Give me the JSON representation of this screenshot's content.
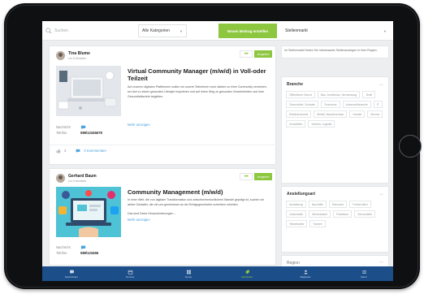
{
  "topbar": {
    "search_placeholder": "Suchen",
    "category_value": "Alle Kategorien",
    "new_post_label": "Neuen Beitrag erstellen",
    "market_label": "Stellenmarkt"
  },
  "posts": [
    {
      "author": "Tina Blume",
      "author_sub": "vor 6 Monaten",
      "badge": "Angebot",
      "title": "Virtual Community Manager (m/w/d) in Voll-oder Teilzeit",
      "description": "Auf unseren digitalen Plattformen wollen wir unsere Teilnehmer noch stärker zu einer Community vernetzen, sei dort zu einem gesunden Lifestyle inspirieren und auf ihrem Weg zu gesunden Gewohnheiten und ihrer Gesundheitsziele begleiten.",
      "more": "Mehr anzeigen",
      "message_label": "Nachricht",
      "phone_label": "Telefon",
      "phone": "089/12345678",
      "likes": "3",
      "comments": "0 Kommentare"
    },
    {
      "author": "Gerhard Baum",
      "author_sub": "vor 6 Monaten",
      "badge": "Angebot",
      "title": "Community Management (m/w/d)",
      "description": "In einer Welt, die von digitaler Transformation und zwischenmenschlichem Wandel geprägt ist, suchen wir aktive Gestalter, die mit uns gemeinsam an der Erfolgsgeschichte schreiben möchten.",
      "description2": "Das sind Deine Herausforderungen ...",
      "more": "Mehr anzeigen",
      "message_label": "Nachricht",
      "phone_label": "Telefon",
      "phone": "089/123456"
    }
  ],
  "sidebar": {
    "info": "Im Stellenmarkt finden Sie interessante Stellenanzeigen in Ihrer Region.",
    "branche_title": "Branche",
    "branche_chips": [
      "Öffentlicher Dienst",
      "Bau, Architektur, Vermessung",
      "Textil",
      "Gesundheit, Soziales",
      "Tourismus",
      "Automobilbranche",
      "IT",
      "Elektroindustrie",
      "Metall, Maschinenbau",
      "Handel",
      "Service",
      "Immobilien",
      "Verkehr, Logistik"
    ],
    "art_title": "Anstellungsart",
    "art_chips": [
      "Ausbildung",
      "Nachhilfe",
      "Elternzeit",
      "Freiberuflich",
      "Juniorstelle",
      "Werkstudent",
      "Praktikum",
      "Seniorstelle",
      "Teilzeitstelle",
      "Trainee"
    ],
    "region_title": "Region"
  },
  "nav": [
    {
      "label": "Nachrichten",
      "icon": "message-icon",
      "active": false
    },
    {
      "label": "Termine",
      "icon": "calendar-icon",
      "active": false
    },
    {
      "label": "Home",
      "icon": "home-grid-icon",
      "active": false
    },
    {
      "label": "Marktplatz",
      "icon": "tag-icon",
      "active": true
    },
    {
      "label": "Mitglieder",
      "icon": "user-icon",
      "active": false
    },
    {
      "label": "Menü",
      "icon": "menu-icon",
      "active": false
    }
  ],
  "colors": {
    "accent": "#8dc63f",
    "nav_bg": "#1c4e8a",
    "link": "#4aa3df"
  }
}
